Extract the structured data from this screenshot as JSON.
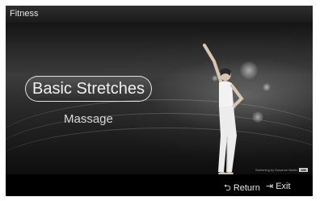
{
  "app": {
    "title": "Fitness"
  },
  "menu": {
    "items": [
      {
        "label": "Basic Stretches",
        "selected": true
      },
      {
        "label": "Massage",
        "selected": false
      }
    ]
  },
  "credit": {
    "text": "Stretching by Susanne Martin",
    "logo": "MM"
  },
  "footer": {
    "return": {
      "icon": "return-icon",
      "label": "Return"
    },
    "exit": {
      "icon": "exit-icon",
      "label": "Exit"
    }
  }
}
